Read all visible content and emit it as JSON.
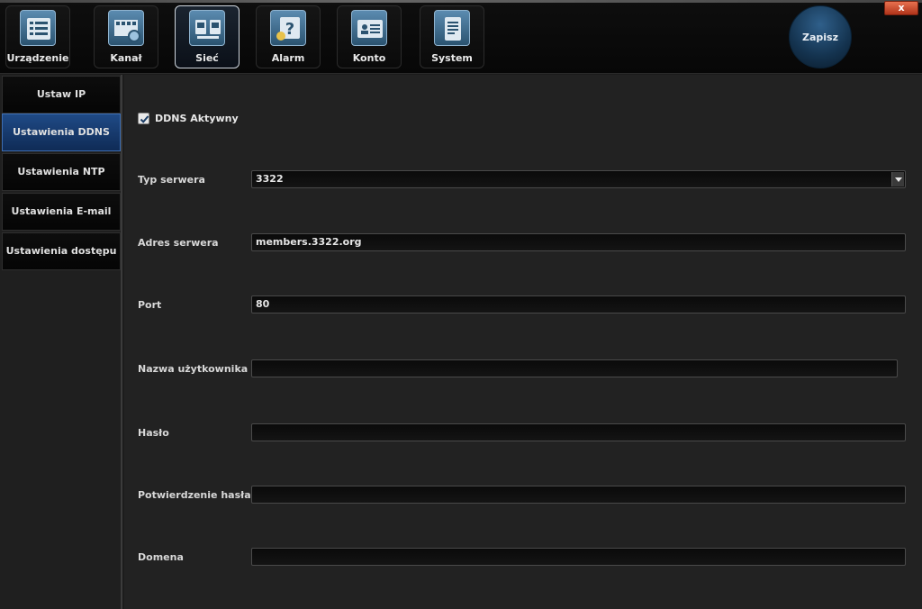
{
  "window": {
    "close_label": "x"
  },
  "tabs": [
    {
      "label": "Urządzenie",
      "icon": "device-list-icon"
    },
    {
      "label": "Kanał",
      "icon": "channel-film-icon"
    },
    {
      "label": "Sieć",
      "icon": "network-computers-icon",
      "active": true
    },
    {
      "label": "Alarm",
      "icon": "alarm-help-icon"
    },
    {
      "label": "Konto",
      "icon": "account-card-icon"
    },
    {
      "label": "System",
      "icon": "system-document-icon"
    }
  ],
  "save_label": "Zapisz",
  "sidebar": {
    "items": [
      {
        "label": "Ustaw IP"
      },
      {
        "label": "Ustawienia DDNS",
        "active": true
      },
      {
        "label": "Ustawienia NTP"
      },
      {
        "label": "Ustawienia E-mail"
      },
      {
        "label": "Ustawienia dostępu"
      }
    ]
  },
  "ddns": {
    "enabled_label": "DDNS Aktywny",
    "enabled": true,
    "fields": {
      "server_type": {
        "label": "Typ serwera",
        "value": "3322"
      },
      "server_address": {
        "label": "Adres serwera",
        "value": "members.3322.org"
      },
      "port": {
        "label": "Port",
        "value": "80"
      },
      "username": {
        "label": "Nazwa użytkownika",
        "value": ""
      },
      "password": {
        "label": "Hasło",
        "value": ""
      },
      "password_confirm": {
        "label": "Potwierdzenie hasła:",
        "value": ""
      },
      "domain": {
        "label": "Domena",
        "value": ""
      }
    }
  },
  "colors": {
    "accent": "#1f4a86",
    "background": "#222222",
    "close": "#c9472a"
  }
}
